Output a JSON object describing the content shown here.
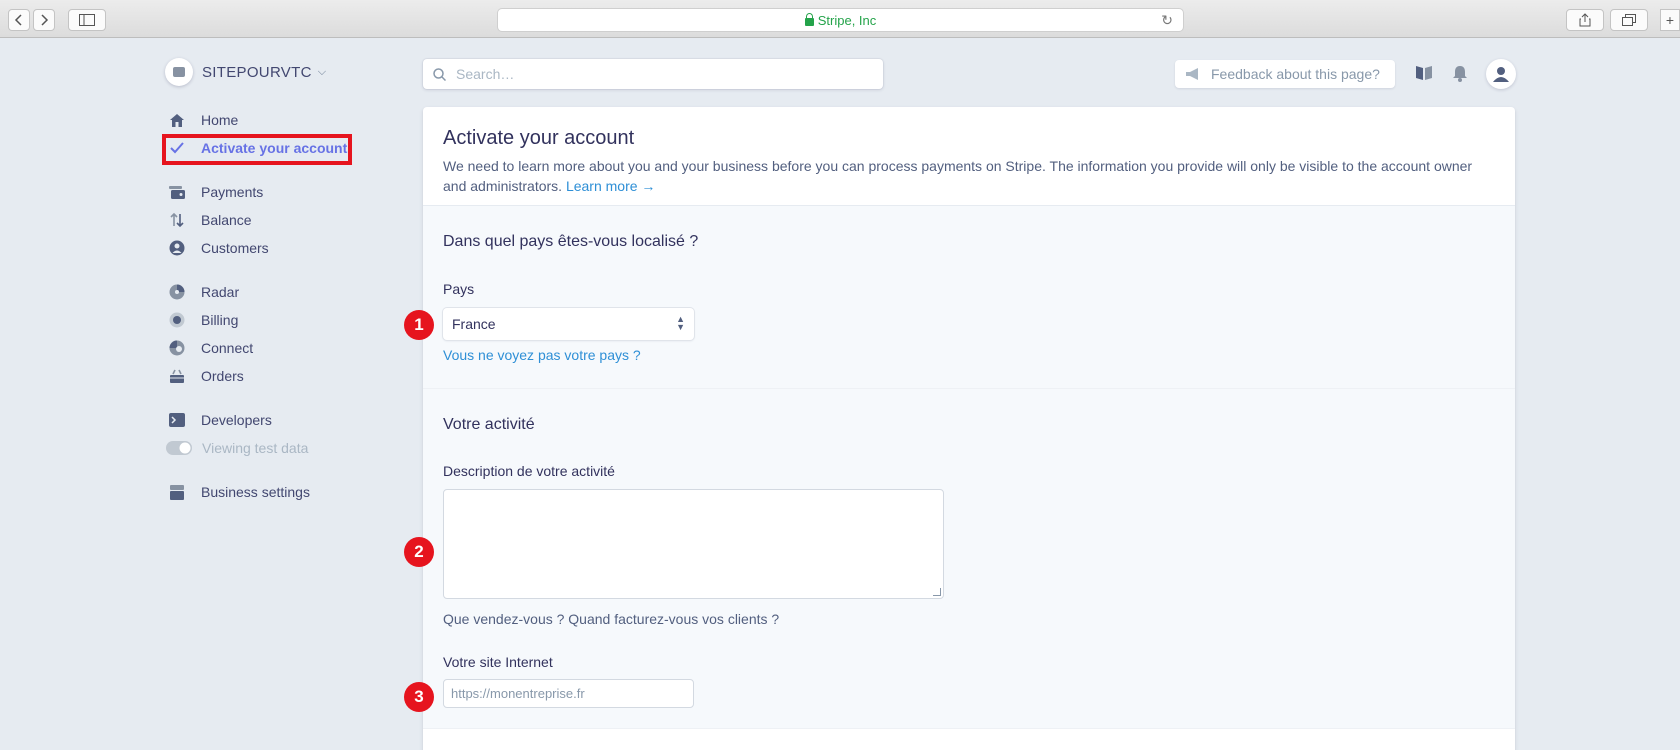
{
  "browser": {
    "url_text": "Stripe, Inc",
    "icons": [
      "chevron-left-icon",
      "chevron-right-icon",
      "sidebar-icon",
      "lock-icon",
      "reload-icon",
      "share-icon",
      "tabs-icon",
      "new-tab-icon"
    ]
  },
  "account": {
    "name": "SITEPOURVTC"
  },
  "sidebar": {
    "items": [
      {
        "label": "Home",
        "icon": "home-icon"
      },
      {
        "label": "Activate your account",
        "icon": "check-icon"
      },
      {
        "label": "Payments",
        "icon": "payments-icon"
      },
      {
        "label": "Balance",
        "icon": "balance-icon"
      },
      {
        "label": "Customers",
        "icon": "customers-icon"
      },
      {
        "label": "Radar",
        "icon": "radar-icon"
      },
      {
        "label": "Billing",
        "icon": "billing-icon"
      },
      {
        "label": "Connect",
        "icon": "connect-icon"
      },
      {
        "label": "Orders",
        "icon": "orders-icon"
      },
      {
        "label": "Developers",
        "icon": "terminal-icon"
      },
      {
        "label": "Viewing test data",
        "icon": "toggle-icon"
      },
      {
        "label": "Business settings",
        "icon": "store-icon"
      }
    ]
  },
  "topbar": {
    "search_placeholder": "Search…",
    "feedback_label": "Feedback about this page?"
  },
  "main": {
    "title": "Activate your account",
    "description": "We need to learn more about you and your business before you can process payments on Stripe. The information you provide will only be visible to the account owner and administrators.",
    "learn_more": "Learn more →",
    "country_section": {
      "title": "Dans quel pays êtes-vous localisé ?",
      "label": "Pays",
      "selected": "France",
      "missing_link": "Vous ne voyez pas votre pays ?"
    },
    "activity_section": {
      "title": "Votre activité",
      "description_label": "Description de votre activité",
      "description_value": "",
      "description_hint": "Que vendez-vous ? Quand facturez-vous vos clients ?",
      "website_label": "Votre site Internet",
      "website_placeholder": "https://monentreprise.fr"
    }
  },
  "markers": [
    "1",
    "2",
    "3"
  ],
  "colors": {
    "accent": "#6772e5",
    "link": "#2e8fd6",
    "highlight": "#e6141e",
    "background": "#e6ebf1"
  }
}
